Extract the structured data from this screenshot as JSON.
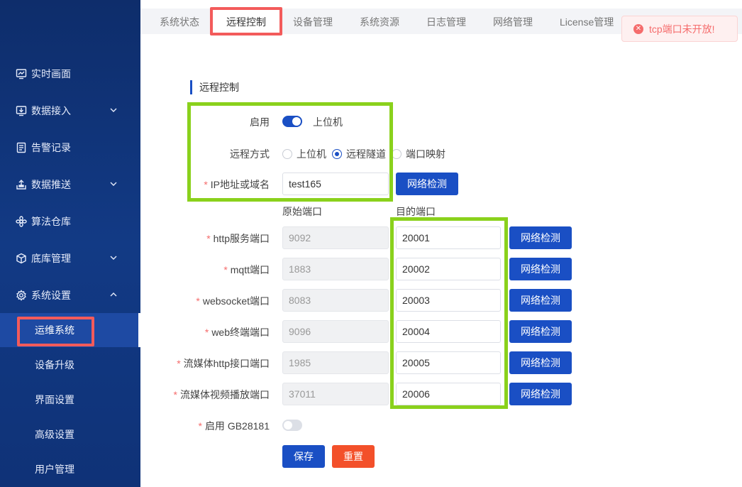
{
  "sidebar": {
    "items": [
      {
        "label": "实时画面",
        "icon": "monitor-chart-icon"
      },
      {
        "label": "数据接入",
        "icon": "download-screen-icon",
        "chevron": "down"
      },
      {
        "label": "告警记录",
        "icon": "document-icon"
      },
      {
        "label": "数据推送",
        "icon": "upload-icon",
        "chevron": "down"
      },
      {
        "label": "算法仓库",
        "icon": "flower-icon"
      },
      {
        "label": "底库管理",
        "icon": "cube-icon",
        "chevron": "down"
      },
      {
        "label": "系统设置",
        "icon": "gear-icon",
        "chevron": "up"
      }
    ],
    "sub_items": [
      {
        "label": "运维系统",
        "active": true
      },
      {
        "label": "设备升级"
      },
      {
        "label": "界面设置"
      },
      {
        "label": "高级设置"
      },
      {
        "label": "用户管理"
      }
    ]
  },
  "tabs": [
    {
      "label": "系统状态"
    },
    {
      "label": "远程控制",
      "active": true
    },
    {
      "label": "设备管理"
    },
    {
      "label": "系统资源"
    },
    {
      "label": "日志管理"
    },
    {
      "label": "网络管理"
    },
    {
      "label": "License管理"
    }
  ],
  "toast": {
    "message": "tcp端口未开放!",
    "color": "#f56c6c"
  },
  "form": {
    "section_title": "远程控制",
    "enable_label": "启用",
    "enable_value": true,
    "enable_text": "上位机",
    "mode_label": "远程方式",
    "mode_options": [
      "上位机",
      "远程隧道",
      "端口映射"
    ],
    "mode_selected": "远程隧道",
    "ip_label": "IP地址或域名",
    "ip_value": "test165",
    "network_check": "网络检测",
    "col_source": "原始端口",
    "col_target": "目的端口",
    "ports": [
      {
        "label": "http服务端口",
        "source": "9092",
        "target": "20001"
      },
      {
        "label": "mqtt端口",
        "source": "1883",
        "target": "20002"
      },
      {
        "label": "websocket端口",
        "source": "8083",
        "target": "20003"
      },
      {
        "label": "web终端端口",
        "source": "9096",
        "target": "20004"
      },
      {
        "label": "流媒体http接口端口",
        "source": "1985",
        "target": "20005"
      },
      {
        "label": "流媒体视频播放端口",
        "source": "37011",
        "target": "20006"
      }
    ],
    "gb_label": "启用 GB28181",
    "gb_value": false,
    "save": "保存",
    "reset": "重置"
  },
  "colors": {
    "primary": "#1a4fc4",
    "danger": "#f3502a",
    "highlight_red": "#f35b5b",
    "highlight_green": "#8ad11c",
    "sidebar_bg": "#123a85"
  }
}
